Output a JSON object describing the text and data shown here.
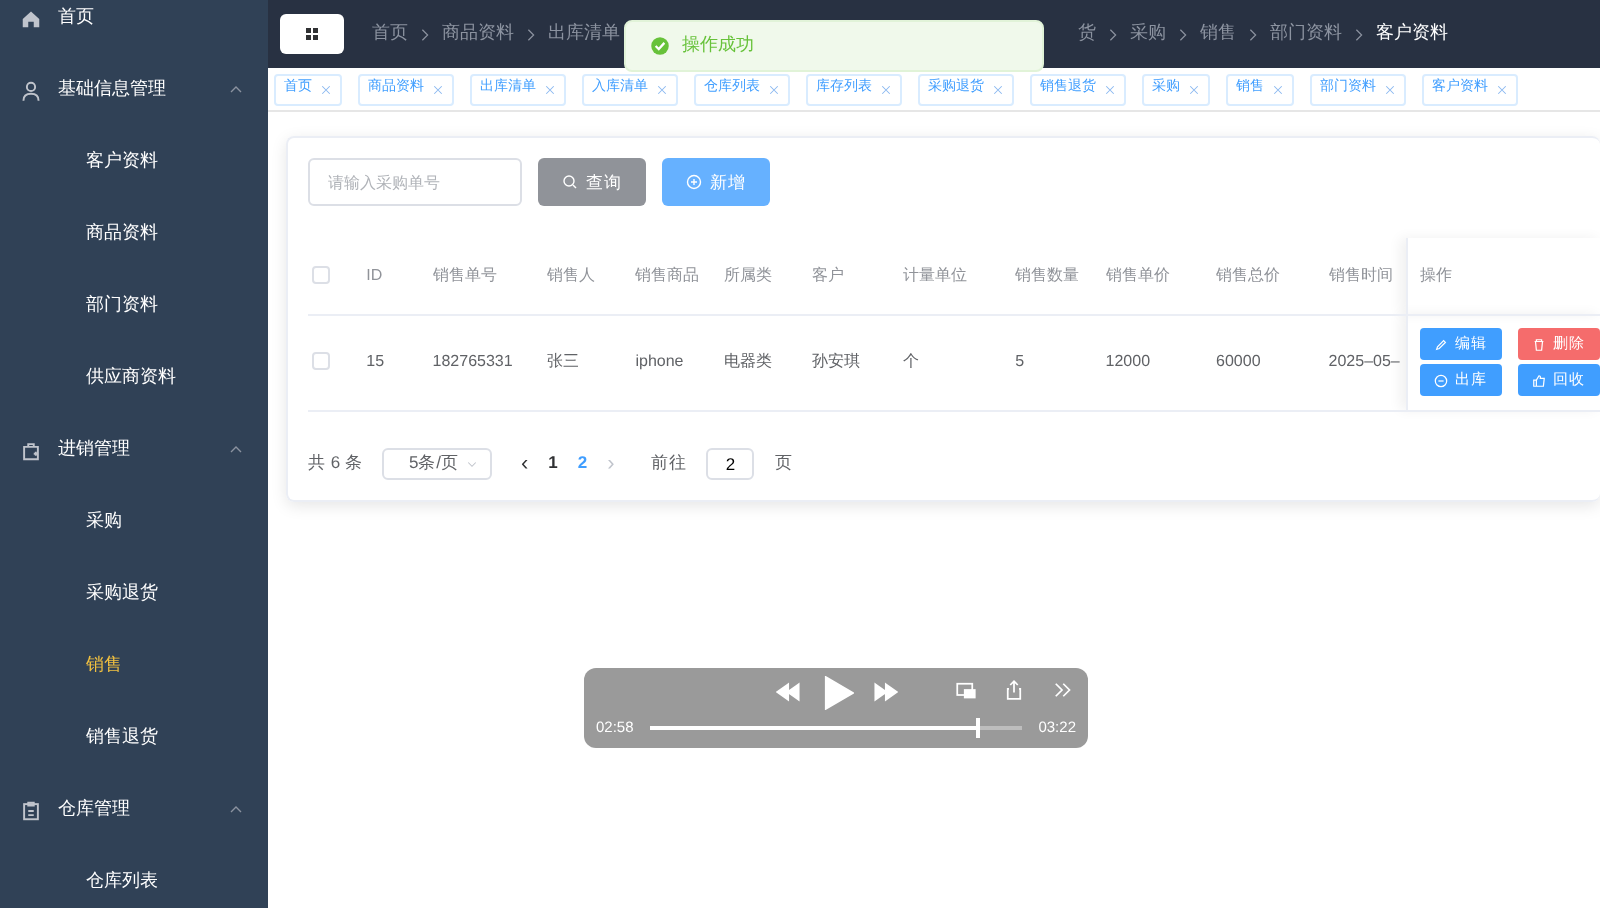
{
  "sidebar": {
    "items": [
      {
        "label": "首页",
        "kind": "link",
        "selected": false
      },
      {
        "label": "基础信息管理",
        "kind": "group",
        "expanded": true,
        "children": [
          {
            "label": "客户资料",
            "selected": false
          },
          {
            "label": "商品资料",
            "selected": false
          },
          {
            "label": "部门资料",
            "selected": false
          },
          {
            "label": "供应商资料",
            "selected": false
          }
        ]
      },
      {
        "label": "进销管理",
        "kind": "group",
        "expanded": true,
        "children": [
          {
            "label": "采购",
            "selected": false
          },
          {
            "label": "采购退货",
            "selected": false
          },
          {
            "label": "销售",
            "selected": true
          },
          {
            "label": "销售退货",
            "selected": false
          }
        ]
      },
      {
        "label": "仓库管理",
        "kind": "group",
        "expanded": true,
        "children": [
          {
            "label": "仓库列表",
            "selected": false
          }
        ]
      }
    ]
  },
  "breadcrumb": {
    "before_toast": [
      "首页",
      "商品资料",
      "出库清单"
    ],
    "after_toast": [
      "货",
      "采购",
      "销售",
      "部门资料",
      "客户资料"
    ]
  },
  "toast": {
    "message": "操作成功"
  },
  "tags": [
    {
      "label": "首页"
    },
    {
      "label": "商品资料"
    },
    {
      "label": "出库清单"
    },
    {
      "label": "入库清单"
    },
    {
      "label": "仓库列表"
    },
    {
      "label": "库存列表"
    },
    {
      "label": "采购退货"
    },
    {
      "label": "销售退货"
    },
    {
      "label": "采购"
    },
    {
      "label": "销售"
    },
    {
      "label": "部门资料"
    },
    {
      "label": "客户资料"
    }
  ],
  "search": {
    "placeholder": "请输入采购单号"
  },
  "buttons": [
    {
      "label": "查询",
      "kind": "search"
    },
    {
      "label": "新增",
      "kind": "add"
    }
  ],
  "table": {
    "header_checked": false,
    "columns": [
      "ID",
      "销售单号",
      "销售人",
      "销售商品",
      "所属类",
      "客户",
      "计量单位",
      "销售数量",
      "销售单价",
      "销售总价",
      "销售时间",
      "操作"
    ],
    "rows": [
      {
        "checked": false,
        "cells": [
          "15",
          "182765331",
          "张三",
          "iphone",
          "电器类",
          "孙安琪",
          "个",
          "5",
          "12000",
          "60000",
          "2025–05–"
        ],
        "actions": [
          {
            "label": "编辑",
            "kind": "edit"
          },
          {
            "label": "删除",
            "kind": "delete"
          },
          {
            "label": "出库",
            "kind": "out"
          },
          {
            "label": "回收",
            "kind": "recycle"
          }
        ]
      }
    ]
  },
  "pagination": {
    "total": "共 6 条",
    "page_size": "5条/页",
    "prev": "‹",
    "next": "›",
    "pages": [
      {
        "label": "1",
        "selected": false
      },
      {
        "label": "2",
        "selected": true
      }
    ],
    "goto_label": "前往",
    "goto_value": "2",
    "goto_suffix": "页"
  },
  "video_controls": {
    "elapsed": "02:58",
    "remaining": "03:22",
    "level": 0.88
  }
}
